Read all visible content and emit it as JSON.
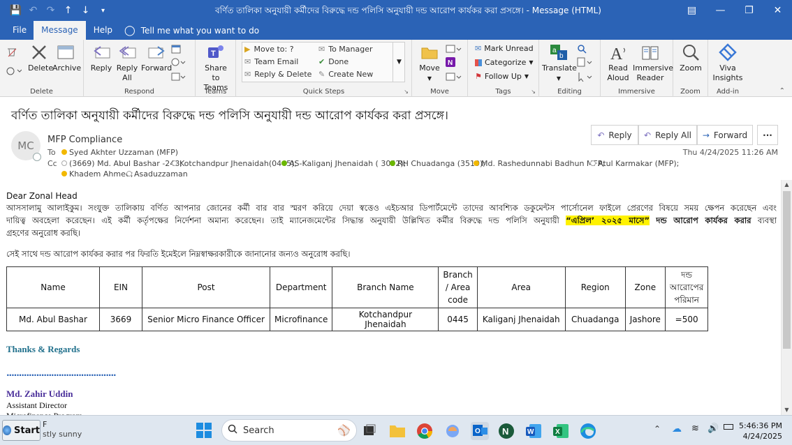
{
  "titlebar": {
    "title": "বর্ণিত তালিকা অনুযায়ী কর্মীদের বিরুদ্ধে দন্ড পলিসি অনুযায়ী দন্ড আরোপ কার্যকর করা প্রসঙ্গে।  -  Message (HTML)"
  },
  "menu": {
    "tabs": [
      "File",
      "Message",
      "Help"
    ],
    "active": "Message",
    "tellme": "Tell me what you want to do"
  },
  "ribbon": {
    "delete_group": {
      "label": "Delete",
      "delete": "Delete",
      "archive": "Archive"
    },
    "respond_group": {
      "label": "Respond",
      "reply": "Reply",
      "reply_all_1": "Reply",
      "reply_all_2": "All",
      "forward": "Forward"
    },
    "teams_group": {
      "label": "Teams",
      "share_1": "Share to",
      "share_2": "Teams"
    },
    "quicksteps": {
      "label": "Quick Steps",
      "move_to": "Move to: ?",
      "team_email": "Team Email",
      "reply_delete": "Reply & Delete",
      "to_manager": "To Manager",
      "done": "Done",
      "create_new": "Create New"
    },
    "move_group": {
      "label": "Move",
      "move": "Move"
    },
    "tags_group": {
      "label": "Tags",
      "mark_unread": "Mark Unread",
      "categorize": "Categorize",
      "follow_up": "Follow Up"
    },
    "editing_group": {
      "label": "Editing",
      "translate": "Translate"
    },
    "immersive_group": {
      "label": "Immersive",
      "read_aloud_1": "Read",
      "read_aloud_2": "Aloud",
      "immersive_reader_1": "Immersive",
      "immersive_reader_2": "Reader"
    },
    "zoom_group": {
      "label": "Zoom",
      "zoom": "Zoom"
    },
    "addin_group": {
      "label": "Add-in",
      "viva_1": "Viva",
      "viva_2": "Insights"
    }
  },
  "message": {
    "subject": "বর্ণিত তালিকা অনুযায়ী কর্মীদের বিরুদ্ধে দন্ড পলিসি অনুযায়ী দন্ড আরোপ কার্যকর করা প্রসঙ্গে।",
    "avatar_initials": "MC",
    "sender": "MFP Compliance",
    "to_label": "To",
    "to": "Syed Akhter Uzzaman (MFP)",
    "cc_label": "Cc",
    "cc": [
      "(3669) Md. Abul Bashar   -248;",
      "Kotchandpur Jhenaidah(0445);",
      "AS-Kaliganj Jhenaidah ( 3052);",
      "RH Chuadanga (3519);",
      "Md. Rashedunnabi Badhun MFP;",
      "Atul  Karmakar (MFP);",
      "Khadem Ahmed;",
      "Asaduzzaman"
    ],
    "date": "Thu 4/24/2025 11:26 AM",
    "actions": {
      "reply": "Reply",
      "reply_all": "Reply All",
      "forward": "Forward",
      "more": "···"
    }
  },
  "body": {
    "greeting": "Dear Zonal Head",
    "para1_line1": "আসসালামু আলাইকুম। সংযুক্ত তালিকায় বর্ণিত আপনার জোনের কর্মী বার বার স্মরণ করিয়ে দেয়া স্বত্তেও এইচআর ডিপার্টমেন্টে তাদের আবশ্যিক ডকুমেন্টস পার্সোনেল ফাইলে প্রেরণের বিষয়ে সময় ক্ষেপন করেছেন এবং",
    "para1_line2a": "দায়িত্ব অবহেলা করেছেন। এই কর্মী কর্তৃপক্ষের নির্দেশনা অমান্য করেছেন। তাই ম্যানেজমেন্টের সিদ্ধান্ত অনুযায়ী উল্লিখিত কর্মীর বিরুদ্ধে দন্ড পলিসি অনুযায়ী",
    "para1_highlight": "“এপ্রিল’ ২০২৫ মাসে”",
    "para1_bold": "দন্ড আরোপ কার্যকর করার",
    "para1_line2b": "ব্যবস্থা",
    "para1_line3": "গ্রহণের অনুরোধ করছি।",
    "para2": "সেই সাথে দন্ড আরোপ কার্যকর করার পর ফিরতি ইমেইলে নিম্নস্বাক্ষরকারীকে জানানোর জন্যও অনুরোধ করছি।",
    "table": {
      "headers": [
        "Name",
        "EIN",
        "Post",
        "Department",
        "Branch  Name",
        "Branch / Area code",
        "Area",
        "Region",
        "Zone",
        "দন্ড আরোপের পরিমান"
      ],
      "row": [
        "Md.  Abul  Bashar",
        "3669",
        "Senior  Micro  Finance  Officer",
        "Microfinance",
        "Kotchandpur  Jhenaidah",
        "0445",
        "Kaliganj  Jhenaidah",
        "Chuadanga",
        "Jashore",
        "=500"
      ]
    },
    "thanks": "Thanks & Regards",
    "dots": "............................................",
    "sig_name": "Md. Zahir Uddin",
    "sig_title": "Assistant Director",
    "sig_dept": "Microfinance Program"
  },
  "taskbar": {
    "start": "Start",
    "weather_temp": "F",
    "weather_desc": "stly sunny",
    "search": "Search",
    "time": "5:46:36 PM",
    "date": "4/24/2025"
  }
}
